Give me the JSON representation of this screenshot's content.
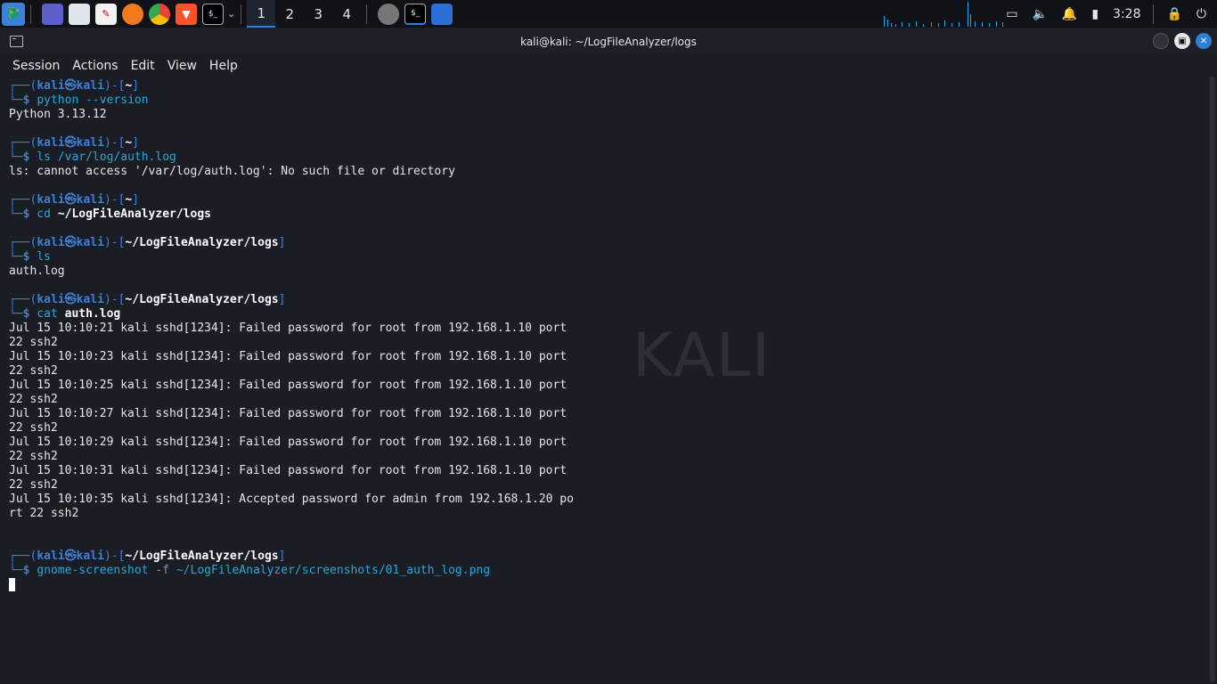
{
  "panel": {
    "workspaces": [
      "1",
      "2",
      "3",
      "4"
    ],
    "clock": "3:28"
  },
  "window": {
    "title": "kali@kali: ~/LogFileAnalyzer/logs"
  },
  "menu": [
    "Session",
    "Actions",
    "Edit",
    "View",
    "Help"
  ],
  "watermark": "KALI",
  "terminal": {
    "blocks": [
      {
        "user": "kali",
        "host": "kali",
        "dir": "~",
        "cmd": "python",
        "args": "--version",
        "args_style": "cmd",
        "output": [
          "Python 3.13.12"
        ]
      },
      {
        "user": "kali",
        "host": "kali",
        "dir": "~",
        "cmd": "ls",
        "args": "/var/log/auth.log",
        "args_style": "cmd",
        "output": [
          "ls: cannot access '/var/log/auth.log': No such file or directory"
        ]
      },
      {
        "user": "kali",
        "host": "kali",
        "dir": "~",
        "cmd": "cd",
        "args": "~/LogFileAnalyzer/logs",
        "args_style": "arg",
        "output": []
      },
      {
        "user": "kali",
        "host": "kali",
        "dir": "~/LogFileAnalyzer/logs",
        "cmd": "ls",
        "args": "",
        "args_style": "arg",
        "output": [
          "auth.log"
        ]
      },
      {
        "user": "kali",
        "host": "kali",
        "dir": "~/LogFileAnalyzer/logs",
        "cmd": "cat",
        "args": "auth.log",
        "args_style": "arg",
        "output": [
          "Jul 15 10:10:21 kali sshd[1234]: Failed password for root from 192.168.1.10 port",
          "22 ssh2",
          "Jul 15 10:10:23 kali sshd[1234]: Failed password for root from 192.168.1.10 port",
          "22 ssh2",
          "Jul 15 10:10:25 kali sshd[1234]: Failed password for root from 192.168.1.10 port",
          "22 ssh2",
          "Jul 15 10:10:27 kali sshd[1234]: Failed password for root from 192.168.1.10 port",
          "22 ssh2",
          "Jul 15 10:10:29 kali sshd[1234]: Failed password for root from 192.168.1.10 port",
          "22 ssh2",
          "Jul 15 10:10:31 kali sshd[1234]: Failed password for root from 192.168.1.10 port",
          "22 ssh2",
          "Jul 15 10:10:35 kali sshd[1234]: Accepted password for admin from 192.168.1.20 po",
          "rt 22 ssh2",
          ""
        ]
      },
      {
        "user": "kali",
        "host": "kali",
        "dir": "~/LogFileAnalyzer/logs",
        "cmd": "gnome-screenshot",
        "flag": "-f",
        "args": "~/LogFileAnalyzer/screenshots/01_auth_log.png",
        "args_style": "cmd",
        "output": []
      }
    ]
  }
}
